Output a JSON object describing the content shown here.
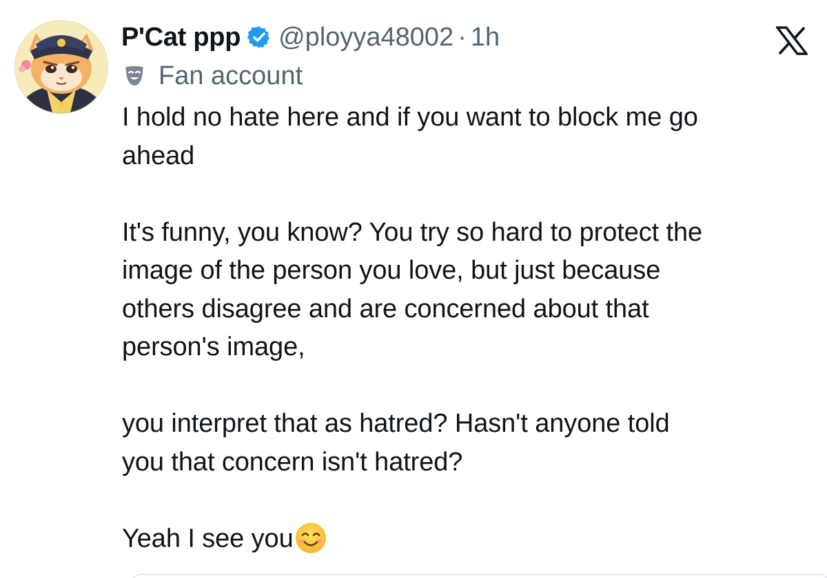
{
  "tweet": {
    "display_name": "P'Cat ppp",
    "handle": "@ployya48002",
    "separator": "·",
    "time": "1h",
    "label": "Fan account",
    "paragraphs": [
      "I hold no hate here and if you want to block me go\nahead",
      "It's funny, you know? You try so hard to protect the\nimage of the person you love, but just because\nothers disagree and are concerned about that\nperson's image,",
      "you interpret that as hatred? Hasn't anyone told\nyou that concern isn't hatred?",
      "Yeah I see you"
    ]
  },
  "icons": {
    "verified": "verified-badge-icon",
    "label": "theater-mask-icon",
    "platform": "x-logo-icon",
    "emoji": "smiling-face-emoji"
  },
  "colors": {
    "text": "#0f1419",
    "secondary": "#536471",
    "verified": "#1d9bf0"
  }
}
